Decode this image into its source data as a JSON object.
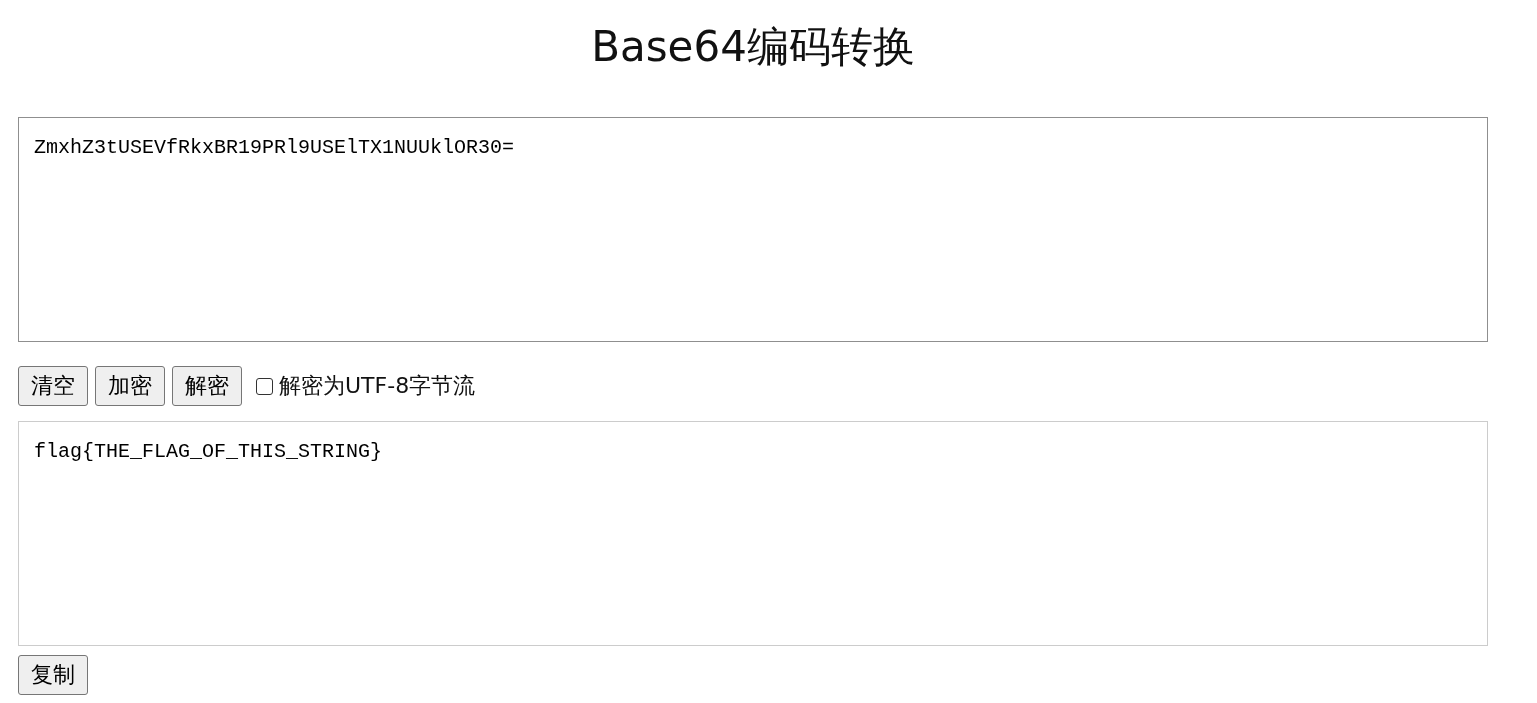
{
  "title": "Base64编码转换",
  "input": {
    "value": "ZmxhZ3tUSEVfRkxBR19PRl9USElTX1NUUklOR30="
  },
  "actions": [
    {
      "label": "清空"
    },
    {
      "label": "加密"
    },
    {
      "label": "解密"
    }
  ],
  "utf8_option": {
    "label": "解密为UTF-8字节流",
    "checked": false
  },
  "output": {
    "value": "flag{THE_FLAG_OF_THIS_STRING}"
  },
  "copy_button": {
    "label": "复制"
  }
}
